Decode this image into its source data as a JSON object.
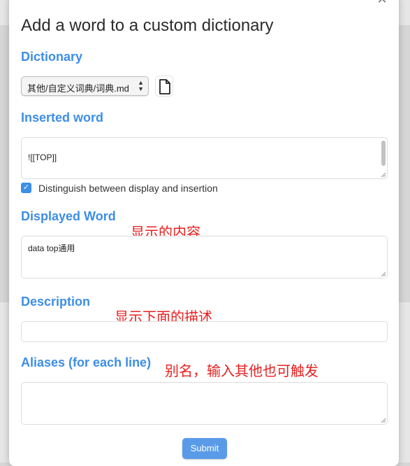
{
  "dialog": {
    "title": "Add a word to a custom dictionary",
    "close_icon": "close-icon"
  },
  "dictionary": {
    "label": "Dictionary",
    "selected": "其他/自定义词典/词典.md",
    "file_icon": "file-icon"
  },
  "inserted_word": {
    "label": "Inserted word",
    "value": "![[TOP]]"
  },
  "distinguish": {
    "label": "Distinguish between display and insertion",
    "checked": true
  },
  "displayed_word": {
    "label": "Displayed Word",
    "value": "data top通用",
    "annotation": "显示的内容"
  },
  "description": {
    "label": "Description",
    "value": "",
    "annotation": "显示下面的描述"
  },
  "aliases": {
    "label": "Aliases (for each line)",
    "value": "",
    "annotation": "别名，输入其他也可触发"
  },
  "submit": {
    "label": "Submit"
  },
  "colors": {
    "accent": "#3d8ee6",
    "annotation": "#e82020",
    "submit": "#5a9be9"
  }
}
